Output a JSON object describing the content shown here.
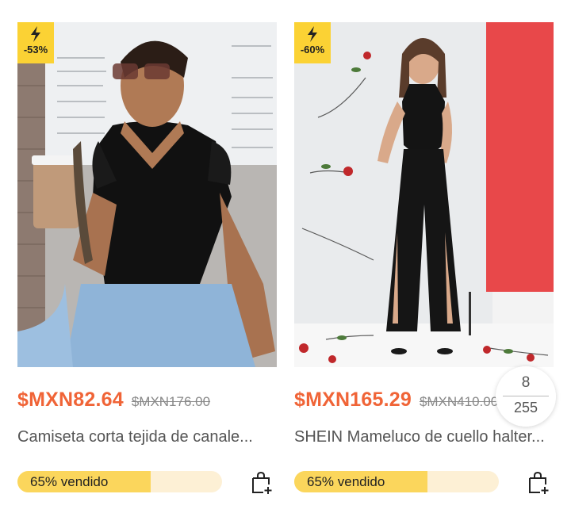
{
  "products": [
    {
      "discount": "-53%",
      "price": "$MXN82.64",
      "original_price": "$MXN176.00",
      "title": "Camiseta corta tejida de canale...",
      "sold_label": "65% vendido",
      "sold_percent": 65,
      "icon": "flash-icon"
    },
    {
      "discount": "-60%",
      "price": "$MXN165.29",
      "original_price": "$MXN410.00",
      "title": "SHEIN Mameluco de cuello halter...",
      "sold_label": "65% vendido",
      "sold_percent": 65,
      "icon": "flash-icon"
    }
  ],
  "pager": {
    "current": "8",
    "total": "255"
  },
  "colors": {
    "price": "#f06437",
    "badge": "#fbd234",
    "bar_fill": "#fbd65c",
    "bar_bg": "#fdf0d5"
  }
}
